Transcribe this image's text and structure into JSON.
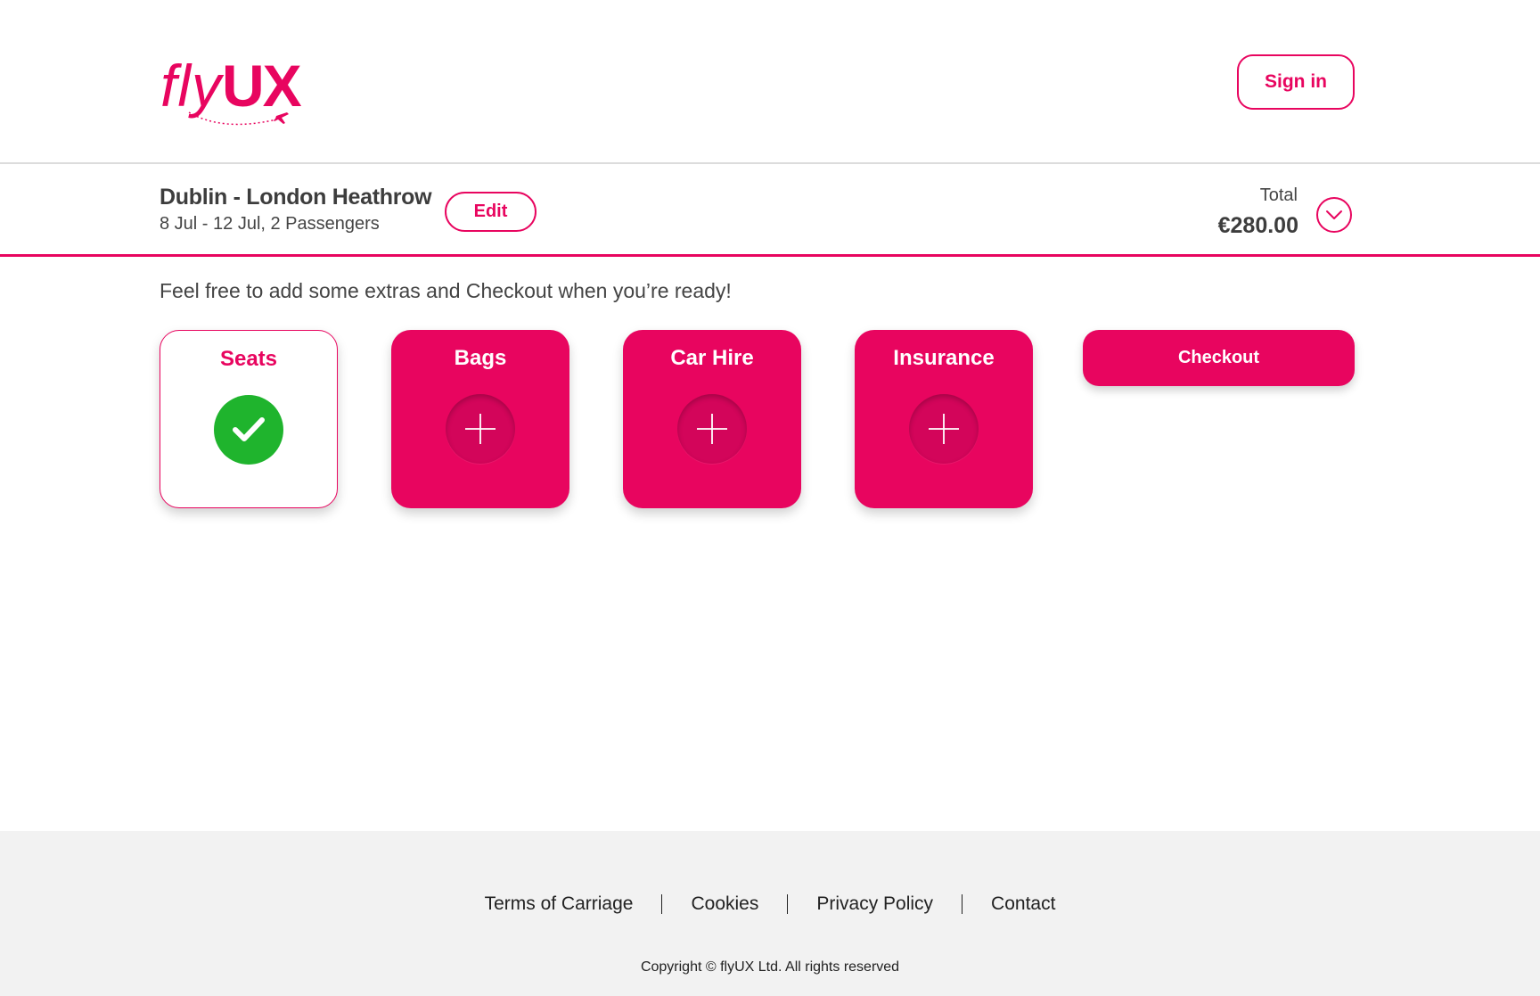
{
  "brand": {
    "logo_light": "fly",
    "logo_bold": "UX",
    "color": "#e8055f"
  },
  "header": {
    "signin_label": "Sign in"
  },
  "trip": {
    "route": "Dublin - London Heathrow",
    "details": "8 Jul - 12 Jul, 2 Passengers",
    "edit_label": "Edit",
    "total_label": "Total",
    "total_value": "€280.00",
    "toggle_icon": "chevron-down-icon"
  },
  "main": {
    "intro": "Feel free to add some extras and Checkout when you’re ready!",
    "extras": [
      {
        "label": "Seats",
        "status": "added",
        "icon": "check-icon",
        "status_color": "#1fb42d"
      },
      {
        "label": "Bags",
        "status": "not-added",
        "icon": "plus-icon"
      },
      {
        "label": "Car Hire",
        "status": "not-added",
        "icon": "plus-icon"
      },
      {
        "label": "Insurance",
        "status": "not-added",
        "icon": "plus-icon"
      }
    ],
    "checkout_label": "Checkout"
  },
  "footer": {
    "links": [
      "Terms of Carriage",
      "Cookies",
      "Privacy Policy",
      "Contact"
    ],
    "copyright": "Copyright © flyUX Ltd. All rights reserved"
  }
}
